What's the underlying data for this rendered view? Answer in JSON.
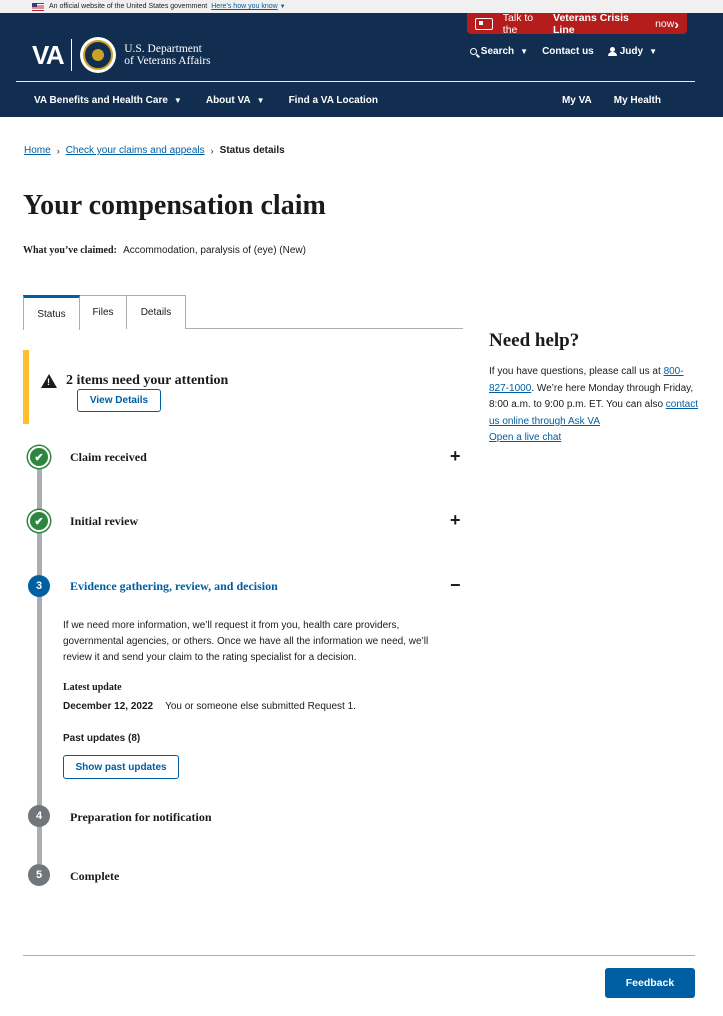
{
  "gov_banner": {
    "text": "An official website of the United States government",
    "link": "Here’s how you know"
  },
  "crisis": {
    "prefix": "Talk to the",
    "bold": "Veterans Crisis Line",
    "suffix": "now"
  },
  "header": {
    "logo": "VA",
    "dept_line1": "U.S. Department",
    "dept_line2": "of Veterans Affairs",
    "search": "Search",
    "contact": "Contact us",
    "user": "Judy"
  },
  "nav": {
    "items": [
      "VA Benefits and Health Care",
      "About VA",
      "Find a VA Location"
    ],
    "right": [
      "My VA",
      "My Health"
    ]
  },
  "breadcrumb": {
    "home": "Home",
    "claims": "Check your claims and appeals",
    "current": "Status details"
  },
  "page_title": "Your compensation claim",
  "claimed": {
    "label": "What you’ve claimed:",
    "value": "Accommodation, paralysis of (eye) (New)"
  },
  "tabs": [
    "Status",
    "Files",
    "Details"
  ],
  "alert": {
    "title": "2 items need your attention",
    "button": "View Details"
  },
  "steps": [
    {
      "num": "",
      "title": "Claim received",
      "toggle": "+"
    },
    {
      "num": "",
      "title": "Initial review",
      "toggle": "+"
    },
    {
      "num": "3",
      "title": "Evidence gathering, review, and decision",
      "toggle": "−"
    },
    {
      "num": "4",
      "title": "Preparation for notification"
    },
    {
      "num": "5",
      "title": "Complete"
    }
  ],
  "step3": {
    "body": "If we need more information, we’ll request it from you, health care providers, governmental agencies, or others. Once we have all the information we need, we’ll review it and send your claim to the rating specialist for a decision.",
    "latest_label": "Latest update",
    "latest_date": "December 12, 2022",
    "latest_text": "You or someone else submitted Request 1.",
    "past_label": "Past updates (8)",
    "show_past": "Show past updates"
  },
  "help": {
    "title": "Need help?",
    "text1": "If you have questions, please call us at",
    "phone": "800-827-1000",
    "text2": ". We’re here Monday through Friday, 8:00 a.m. to 9:00 p.m. ET. You can also",
    "contact_link": "contact us online through Ask VA",
    "chat": "Open a live chat"
  },
  "feedback": "Feedback"
}
